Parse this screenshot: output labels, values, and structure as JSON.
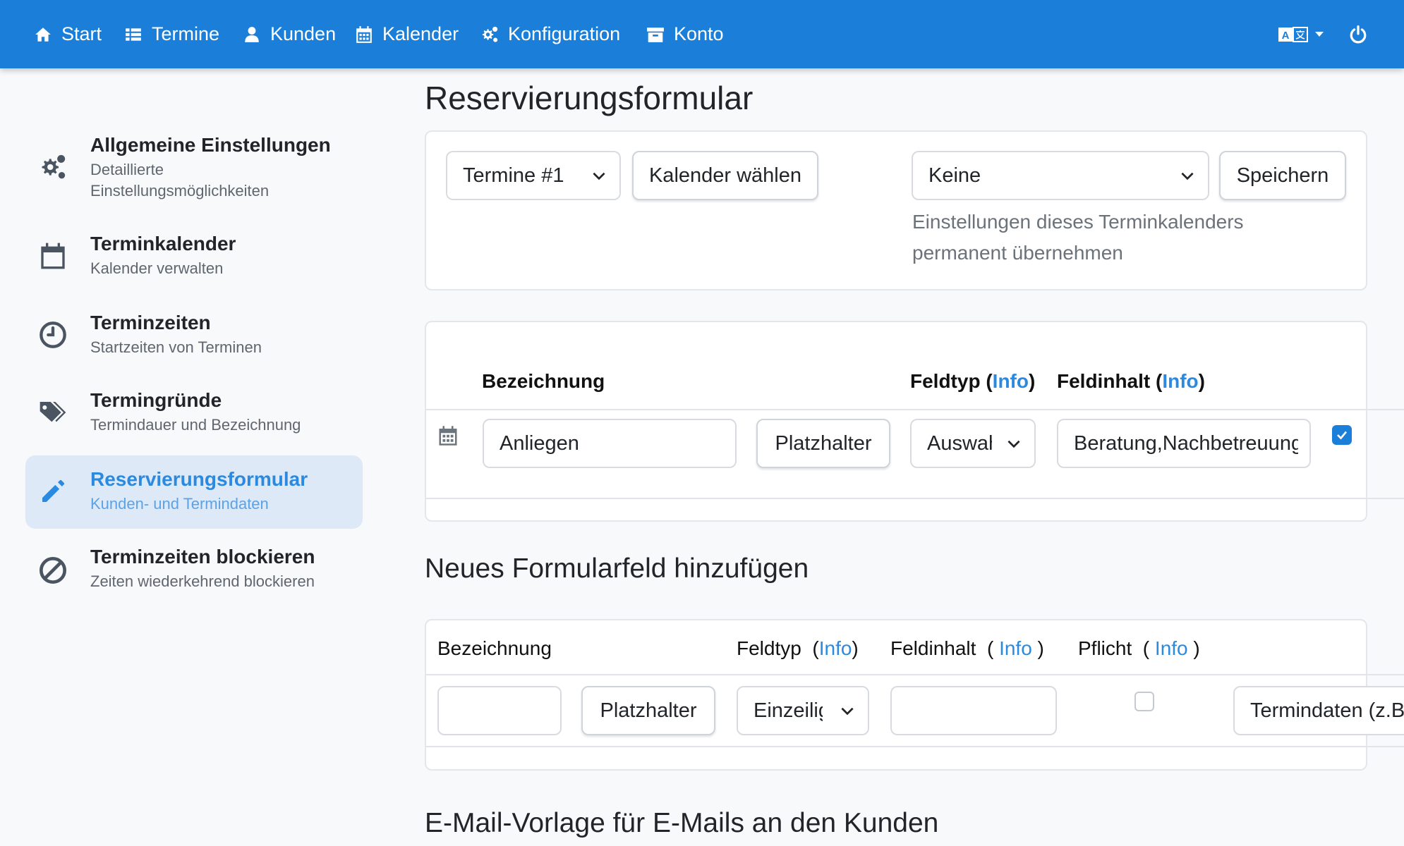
{
  "nav": {
    "items": [
      {
        "label": "Start",
        "icon": "home-icon"
      },
      {
        "label": "Termine",
        "icon": "list-icon"
      },
      {
        "label": "Kunden",
        "icon": "user-icon"
      },
      {
        "label": "Kalender",
        "icon": "calendar-icon"
      },
      {
        "label": "Konfiguration",
        "icon": "gears-icon"
      },
      {
        "label": "Konto",
        "icon": "archive-icon"
      }
    ],
    "right_icons": [
      "language-icon",
      "power-icon"
    ]
  },
  "sidebar": {
    "items": [
      {
        "title": "Allgemeine Einstellungen",
        "subtitle": "Detaillierte Einstellungsmöglichkeiten",
        "icon": "gears-icon",
        "active": false
      },
      {
        "title": "Terminkalender",
        "subtitle": "Kalender verwalten",
        "icon": "calendar-icon",
        "active": false
      },
      {
        "title": "Terminzeiten",
        "subtitle": "Startzeiten von Terminen",
        "icon": "clock-icon",
        "active": false
      },
      {
        "title": "Termingründe",
        "subtitle": "Termindauer und Bezeichnung",
        "icon": "tags-icon",
        "active": false
      },
      {
        "title": "Reservierungsformular",
        "subtitle": "Kunden- und Termindaten",
        "icon": "pencil-icon",
        "active": true
      },
      {
        "title": "Terminzeiten blockieren",
        "subtitle": "Zeiten wiederkehrend blockieren",
        "icon": "ban-icon",
        "active": false
      }
    ]
  },
  "main": {
    "title": "Reservierungsformular",
    "top_card": {
      "termine_select": "Termine #1",
      "kalender_button": "Kalender wählen",
      "preset_select": "Keine",
      "save_button": "Speichern",
      "hint": "Einstellungen dieses Terminkalenders permanent übernehmen"
    },
    "fields_table": {
      "headers": {
        "bezeichnung": "Bezeichnung",
        "feldtyp": "Feldtyp",
        "feldinhalt": "Feldinhalt",
        "info": "Info"
      },
      "row": {
        "bezeichnung": "Anliegen",
        "platzhalter_button": "Platzhalter",
        "feldtyp": "Auswahl",
        "feldinhalt": "Beratung,Nachbetreuung",
        "checked": true
      }
    },
    "new_field": {
      "title": "Neues Formularfeld hinzufügen",
      "headers": {
        "bezeichnung": "Bezeichnung",
        "feldtyp": "Feldtyp",
        "feldinhalt": "Feldinhalt",
        "pflicht": "Pflicht",
        "info": "Info"
      },
      "row": {
        "bezeichnung_value": "",
        "platzhalter_button": "Platzhalter",
        "feldtyp": "Einzeilig",
        "feldinhalt_value": "",
        "pflicht_checked": false,
        "ziel_select": "Termindaten (z.B."
      }
    },
    "email_section_title": "E-Mail-Vorlage für E-Mails an den Kunden"
  }
}
